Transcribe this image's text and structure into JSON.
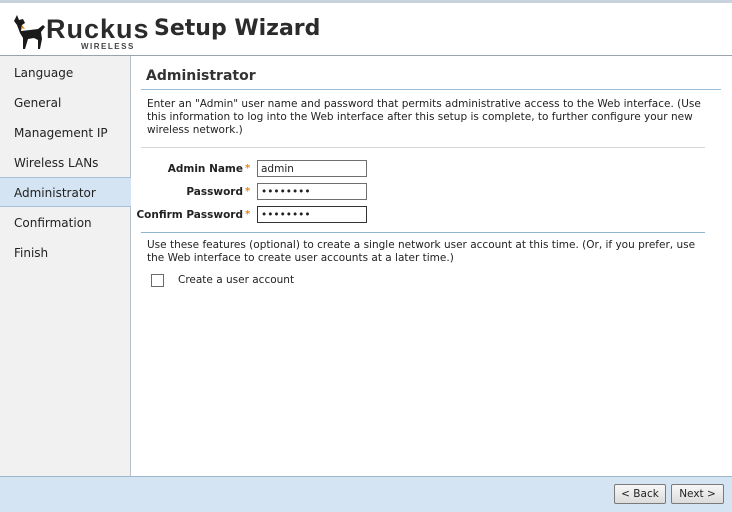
{
  "header": {
    "brand": "Ruckus",
    "brand_tm": "™",
    "brand_sub": "WIRELESS",
    "title": "Setup Wizard"
  },
  "sidebar": {
    "items": [
      {
        "label": "Language"
      },
      {
        "label": "General"
      },
      {
        "label": "Management IP"
      },
      {
        "label": "Wireless LANs"
      },
      {
        "label": "Administrator",
        "active": true
      },
      {
        "label": "Confirmation"
      },
      {
        "label": "Finish"
      }
    ]
  },
  "main": {
    "title": "Administrator",
    "intro": "Enter an \"Admin\" user name and password that permits administrative access to the Web interface. (Use this information to log into the Web interface after this setup is complete, to further configure your new wireless network.)",
    "fields": {
      "admin_name": {
        "label": "Admin Name",
        "value": "admin",
        "required": "*"
      },
      "password": {
        "label": "Password",
        "value": "••••••••",
        "required": "*"
      },
      "confirm_password": {
        "label": "Confirm Password",
        "value": "••••••••",
        "required": "*"
      }
    },
    "optional_text": "Use these features (optional) to create a single network user account at this time. (Or, if you prefer, use the Web interface to create user accounts at a later time.)",
    "create_user_label": "Create a user account",
    "create_user_checked": false
  },
  "footer": {
    "back_label": "< Back",
    "next_label": "Next >"
  },
  "colors": {
    "accent": "#d4e4f2",
    "required": "#e08a1a",
    "rule": "#9cc0dc"
  },
  "icons": {
    "logo": "dog-icon",
    "checkbox": "checkbox-unchecked-icon"
  }
}
